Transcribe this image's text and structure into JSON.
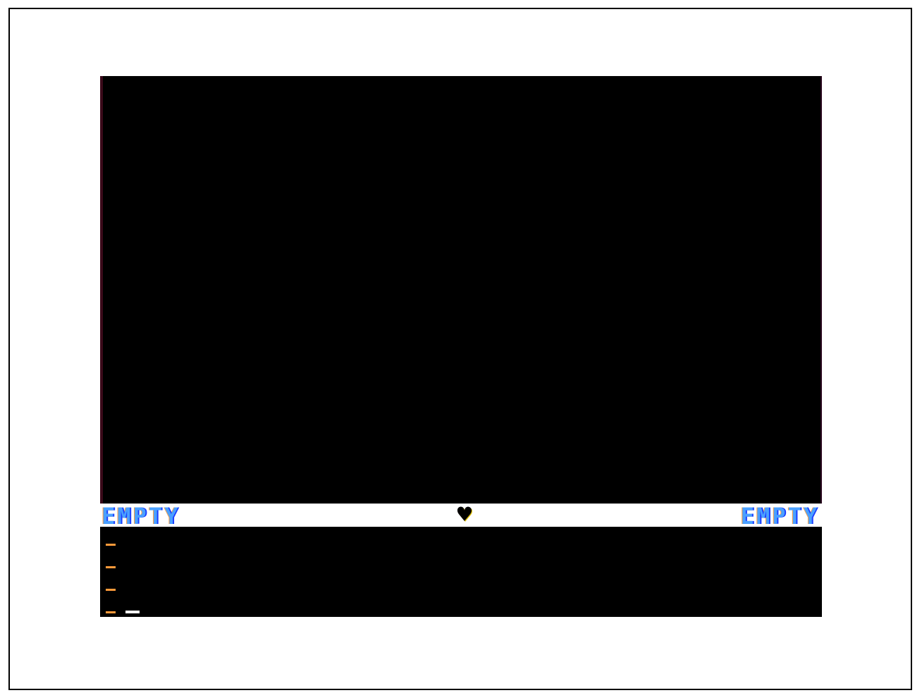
{
  "status_bar": {
    "left_slot": "EMPTY",
    "right_slot": "EMPTY",
    "center_icon": "heart-icon"
  },
  "message_area": {
    "prompt_lines": 4,
    "cursor": true
  },
  "colors": {
    "viewport_background": "#000000",
    "status_bar_background": "#ffffff",
    "slot_text": "#4aa0ff",
    "prompt_marker": "#ff9a3a",
    "cursor": "#ffffff"
  }
}
